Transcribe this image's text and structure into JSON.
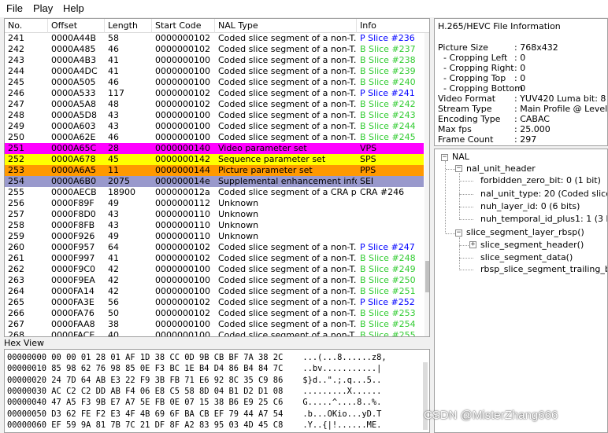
{
  "menu": [
    "File",
    "Play",
    "Help"
  ],
  "table": {
    "columns": [
      "No.",
      "Offset",
      "Length",
      "Start Code",
      "NAL Type",
      "Info"
    ],
    "rows": [
      {
        "no": "241",
        "offset": "0000A44B",
        "length": "58",
        "start": "0000000102",
        "nal": "Coded slice segment of a non-T...",
        "info": "P Slice #236",
        "bg": "#ffffff",
        "info_color": "#0000ff"
      },
      {
        "no": "242",
        "offset": "0000A485",
        "length": "46",
        "start": "0000000102",
        "nal": "Coded slice segment of a non-T...",
        "info": "B Slice #237",
        "bg": "#ffffff",
        "info_color": "#33cc33"
      },
      {
        "no": "243",
        "offset": "0000A4B3",
        "length": "41",
        "start": "0000000100",
        "nal": "Coded slice segment of a non-T...",
        "info": "B Slice #238",
        "bg": "#ffffff",
        "info_color": "#33cc33"
      },
      {
        "no": "244",
        "offset": "0000A4DC",
        "length": "41",
        "start": "0000000100",
        "nal": "Coded slice segment of a non-T...",
        "info": "B Slice #239",
        "bg": "#ffffff",
        "info_color": "#33cc33"
      },
      {
        "no": "245",
        "offset": "0000A505",
        "length": "46",
        "start": "0000000100",
        "nal": "Coded slice segment of a non-T...",
        "info": "B Slice #240",
        "bg": "#ffffff",
        "info_color": "#33cc33"
      },
      {
        "no": "246",
        "offset": "0000A533",
        "length": "117",
        "start": "0000000102",
        "nal": "Coded slice segment of a non-T...",
        "info": "P Slice #241",
        "bg": "#ffffff",
        "info_color": "#0000ff"
      },
      {
        "no": "247",
        "offset": "0000A5A8",
        "length": "48",
        "start": "0000000102",
        "nal": "Coded slice segment of a non-T...",
        "info": "B Slice #242",
        "bg": "#ffffff",
        "info_color": "#33cc33"
      },
      {
        "no": "248",
        "offset": "0000A5D8",
        "length": "43",
        "start": "0000000100",
        "nal": "Coded slice segment of a non-T...",
        "info": "B Slice #243",
        "bg": "#ffffff",
        "info_color": "#33cc33"
      },
      {
        "no": "249",
        "offset": "0000A603",
        "length": "43",
        "start": "0000000100",
        "nal": "Coded slice segment of a non-T...",
        "info": "B Slice #244",
        "bg": "#ffffff",
        "info_color": "#33cc33"
      },
      {
        "no": "250",
        "offset": "0000A62E",
        "length": "46",
        "start": "0000000100",
        "nal": "Coded slice segment of a non-T...",
        "info": "B Slice #245",
        "bg": "#ffffff",
        "info_color": "#33cc33"
      },
      {
        "no": "251",
        "offset": "0000A65C",
        "length": "28",
        "start": "0000000140",
        "nal": "Video parameter set",
        "info": "VPS",
        "bg": "#ff00ff",
        "info_color": "#000000"
      },
      {
        "no": "252",
        "offset": "0000A678",
        "length": "45",
        "start": "0000000142",
        "nal": "Sequence parameter set",
        "info": "SPS",
        "bg": "#ffff00",
        "info_color": "#000000"
      },
      {
        "no": "253",
        "offset": "0000A6A5",
        "length": "11",
        "start": "0000000144",
        "nal": "Picture parameter set",
        "info": "PPS",
        "bg": "#ff9900",
        "info_color": "#000000"
      },
      {
        "no": "254",
        "offset": "0000A6B0",
        "length": "2075",
        "start": "000000014e",
        "nal": "Supplemental enhancement info...",
        "info": "SEI",
        "bg": "#9999cc",
        "info_color": "#000000"
      },
      {
        "no": "255",
        "offset": "0000AECB",
        "length": "18900",
        "start": "000000012a",
        "nal": "Coded slice segment of a CRA pi...",
        "info": "CRA #246",
        "bg": "#ffffff",
        "info_color": "#000000"
      },
      {
        "no": "256",
        "offset": "0000F89F",
        "length": "49",
        "start": "0000000112",
        "nal": "Unknown",
        "info": "",
        "bg": "#ffffff",
        "info_color": "#000000"
      },
      {
        "no": "257",
        "offset": "0000F8D0",
        "length": "43",
        "start": "0000000110",
        "nal": "Unknown",
        "info": "",
        "bg": "#ffffff",
        "info_color": "#000000"
      },
      {
        "no": "258",
        "offset": "0000F8FB",
        "length": "43",
        "start": "0000000110",
        "nal": "Unknown",
        "info": "",
        "bg": "#ffffff",
        "info_color": "#000000"
      },
      {
        "no": "259",
        "offset": "0000F926",
        "length": "49",
        "start": "0000000110",
        "nal": "Unknown",
        "info": "",
        "bg": "#ffffff",
        "info_color": "#000000"
      },
      {
        "no": "260",
        "offset": "0000F957",
        "length": "64",
        "start": "0000000102",
        "nal": "Coded slice segment of a non-T...",
        "info": "P Slice #247",
        "bg": "#ffffff",
        "info_color": "#0000ff"
      },
      {
        "no": "261",
        "offset": "0000F997",
        "length": "41",
        "start": "0000000102",
        "nal": "Coded slice segment of a non-T...",
        "info": "B Slice #248",
        "bg": "#ffffff",
        "info_color": "#33cc33"
      },
      {
        "no": "262",
        "offset": "0000F9C0",
        "length": "42",
        "start": "0000000100",
        "nal": "Coded slice segment of a non-T...",
        "info": "B Slice #249",
        "bg": "#ffffff",
        "info_color": "#33cc33"
      },
      {
        "no": "263",
        "offset": "0000F9EA",
        "length": "42",
        "start": "0000000100",
        "nal": "Coded slice segment of a non-T...",
        "info": "B Slice #250",
        "bg": "#ffffff",
        "info_color": "#33cc33"
      },
      {
        "no": "264",
        "offset": "0000FA14",
        "length": "42",
        "start": "0000000100",
        "nal": "Coded slice segment of a non-T...",
        "info": "B Slice #251",
        "bg": "#ffffff",
        "info_color": "#33cc33"
      },
      {
        "no": "265",
        "offset": "0000FA3E",
        "length": "56",
        "start": "0000000102",
        "nal": "Coded slice segment of a non-T...",
        "info": "P Slice #252",
        "bg": "#ffffff",
        "info_color": "#0000ff"
      },
      {
        "no": "266",
        "offset": "0000FA76",
        "length": "50",
        "start": "0000000102",
        "nal": "Coded slice segment of a non-T...",
        "info": "B Slice #253",
        "bg": "#ffffff",
        "info_color": "#33cc33"
      },
      {
        "no": "267",
        "offset": "0000FAA8",
        "length": "38",
        "start": "0000000100",
        "nal": "Coded slice segment of a non-T...",
        "info": "B Slice #254",
        "bg": "#ffffff",
        "info_color": "#33cc33"
      },
      {
        "no": "268",
        "offset": "0000FACE",
        "length": "40",
        "start": "0000000100",
        "nal": "Coded slice segment of a non-T...",
        "info": "B Slice #255",
        "bg": "#ffffff",
        "info_color": "#33cc33"
      }
    ]
  },
  "hex": {
    "title": "Hex View",
    "lines": [
      "00000000 00 00 01 28 01 AF 1D 38 CC 0D 9B CB BF 7A 38 2C    ...(...8......z8,",
      "00000010 85 98 62 76 98 85 0E F3 BC 1E B4 D4 86 B4 84 7C    ..bv...........|",
      "00000020 24 7D 64 AB E3 22 F9 3B FB 71 E6 92 8C 35 C9 86    $}d..\".;.q...5..",
      "00000030 AC C2 C2 DD AB F4 06 E8 C5 58 8D 04 B1 D2 D1 08    .........X......",
      "00000040 47 A5 F3 9B E7 A7 5E FB 0E 07 15 38 B6 E9 25 C6    G.....^....8..%.",
      "00000050 D3 62 FE F2 E3 4F 4B 69 6F BA CB EF 79 44 A7 54    .b...OKio...yD.T",
      "00000060 EF 59 9A 81 7B 7C 21 DF 8F A2 83 95 03 4D 45 C8    .Y..{|!......ME."
    ]
  },
  "info": {
    "title": "H.265/HEVC File Information",
    "items": [
      {
        "key": "Picture Size",
        "value": ": 768x432"
      },
      {
        "key": "  - Cropping Left",
        "value": ": 0"
      },
      {
        "key": "  - Cropping Right",
        "value": ": 0"
      },
      {
        "key": "  - Cropping Top",
        "value": ": 0"
      },
      {
        "key": "  - Cropping Bottom",
        "value": ": 0"
      },
      {
        "key": "Video Format",
        "value": ": YUV420 Luma bit: 8 Chr"
      },
      {
        "key": "Stream Type",
        "value": ": Main Profile @ Level 3(9"
      },
      {
        "key": "Encoding Type",
        "value": ": CABAC"
      },
      {
        "key": "Max fps",
        "value": ": 25.000"
      },
      {
        "key": "Frame Count",
        "value": ": 297"
      }
    ]
  },
  "tree": {
    "root": "NAL",
    "nal_unit_header": "nal_unit_header",
    "header_children": [
      "forbidden_zero_bit: 0 (1 bit)",
      "nal_unit_type: 20 (Coded slice se",
      "nuh_layer_id: 0 (6 bits)",
      "nuh_temporal_id_plus1: 1 (3 bits)"
    ],
    "slice_segment_layer_rbsp": "slice_segment_layer_rbsp()",
    "slice_children": [
      "slice_segment_header()",
      "slice_segment_data()",
      "rbsp_slice_segment_trailing_bits("
    ]
  },
  "watermark": "CSDN @MisterZhang666",
  "colors": {
    "p_slice": "#0000ff",
    "b_slice": "#33cc33",
    "vps": "#ff00ff",
    "sps": "#ffff00",
    "pps": "#ff9900",
    "sei": "#9999cc"
  }
}
